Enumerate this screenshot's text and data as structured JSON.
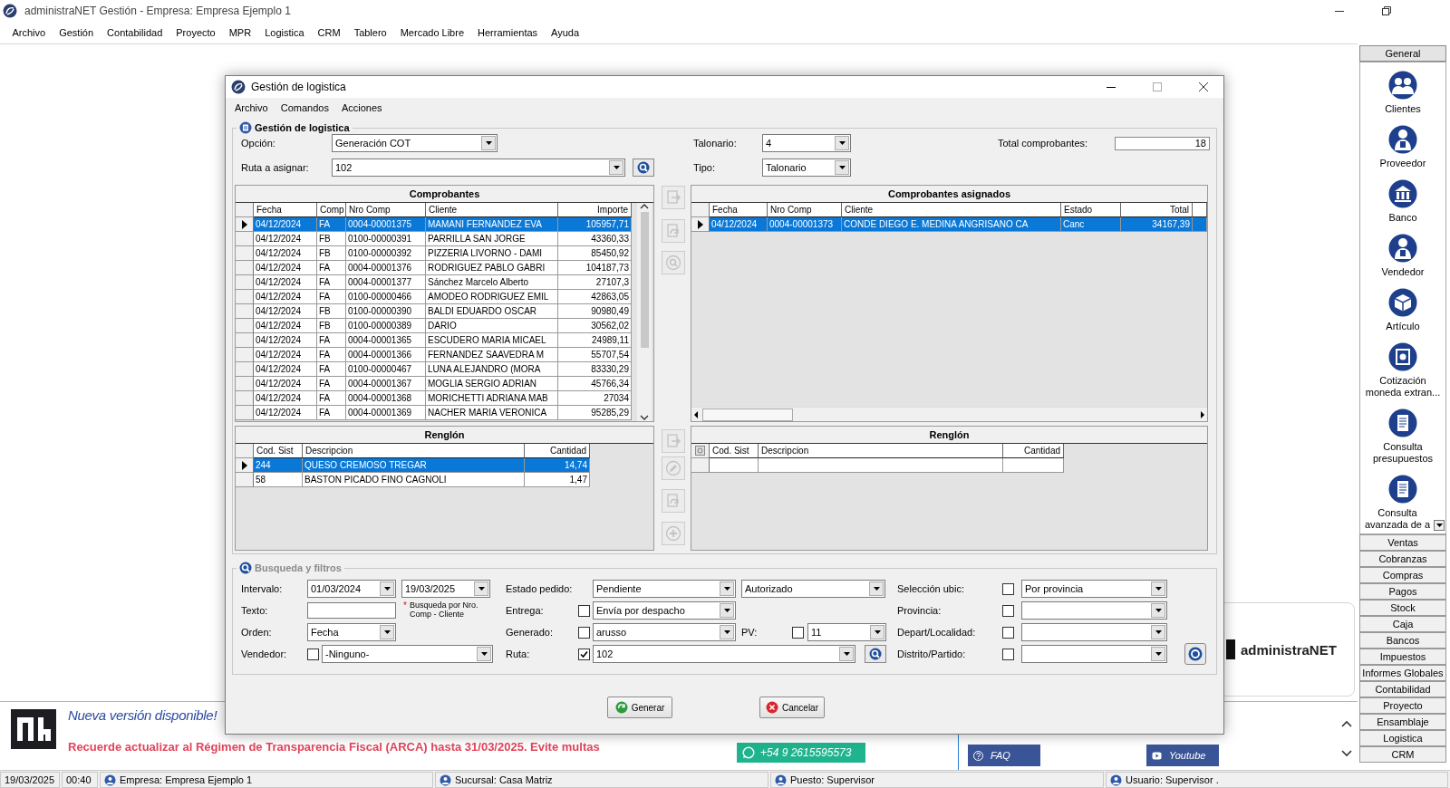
{
  "app_window": {
    "title": "administraNET Gestión - Empresa: Empresa Ejemplo 1",
    "menu": [
      "Archivo",
      "Gestión",
      "Contabilidad",
      "Proyecto",
      "MPR",
      "Logistica",
      "CRM",
      "Tablero",
      "Mercado Libre",
      "Herramientas",
      "Ayuda"
    ]
  },
  "dialog": {
    "title": "Gestión de logistica",
    "menu": [
      "Archivo",
      "Comandos",
      "Acciones"
    ],
    "group_title": "Gestión de logistica",
    "opcion": {
      "label": "Opción:",
      "value": "Generación COT"
    },
    "ruta_asignar": {
      "label": "Ruta a asignar:",
      "value": "102"
    },
    "talonario": {
      "label": "Talonario:",
      "value": "4"
    },
    "tipo": {
      "label": "Tipo:",
      "value": "Talonario"
    },
    "total_comprobantes": {
      "label": "Total comprobantes:",
      "value": "18"
    },
    "comprobantes": {
      "title": "Comprobantes",
      "columns": [
        "Fecha",
        "Comp",
        "Nro Comp",
        "Cliente",
        "Importe"
      ],
      "rows": [
        {
          "cells": [
            "04/12/2024",
            "FA",
            "0004-00001375",
            "MAMANI FERNANDEZ EVA",
            "105957,71"
          ],
          "selected": true
        },
        {
          "cells": [
            "04/12/2024",
            "FB",
            "0100-00000391",
            "PARRILLA SAN JORGE",
            "43360,33"
          ],
          "selected": false
        },
        {
          "cells": [
            "04/12/2024",
            "FB",
            "0100-00000392",
            "PIZZERIA LIVORNO - DAMI",
            "85450,92"
          ],
          "selected": false
        },
        {
          "cells": [
            "04/12/2024",
            "FA",
            "0004-00001376",
            "RODRIGUEZ PABLO GABRI",
            "104187,73"
          ],
          "selected": false
        },
        {
          "cells": [
            "04/12/2024",
            "FA",
            "0004-00001377",
            "Sánchez Marcelo Alberto",
            "27107,3"
          ],
          "selected": false
        },
        {
          "cells": [
            "04/12/2024",
            "FA",
            "0100-00000466",
            "AMODEO RODRIGUEZ EMIL",
            "42863,05"
          ],
          "selected": false
        },
        {
          "cells": [
            "04/12/2024",
            "FB",
            "0100-00000390",
            "BALDI EDUARDO OSCAR",
            "90980,49"
          ],
          "selected": false
        },
        {
          "cells": [
            "04/12/2024",
            "FB",
            "0100-00000389",
            "DARIO",
            "30562,02"
          ],
          "selected": false
        },
        {
          "cells": [
            "04/12/2024",
            "FA",
            "0004-00001365",
            "ESCUDERO MARIA MICAEL",
            "24989,11"
          ],
          "selected": false
        },
        {
          "cells": [
            "04/12/2024",
            "FA",
            "0004-00001366",
            "FERNANDEZ SAAVEDRA M",
            "55707,54"
          ],
          "selected": false
        },
        {
          "cells": [
            "04/12/2024",
            "FA",
            "0100-00000467",
            "LUNA ALEJANDRO (MORA",
            "83330,29"
          ],
          "selected": false
        },
        {
          "cells": [
            "04/12/2024",
            "FA",
            "0004-00001367",
            "MOGLIA SERGIO ADRIAN",
            "45766,34"
          ],
          "selected": false
        },
        {
          "cells": [
            "04/12/2024",
            "FA",
            "0004-00001368",
            "MORICHETTI ADRIANA MAB",
            "27034"
          ],
          "selected": false
        },
        {
          "cells": [
            "04/12/2024",
            "FA",
            "0004-00001369",
            "NACHER MARIA VERONICA",
            "95285,29"
          ],
          "selected": false
        }
      ]
    },
    "renglon": {
      "title": "Renglón",
      "columns": [
        "Cod. Sist",
        "Descripcion",
        "Cantidad"
      ],
      "rows": [
        {
          "cells": [
            "244",
            "QUESO CREMOSO TREGAR",
            "14,74"
          ],
          "selected": true
        },
        {
          "cells": [
            "58",
            "BASTON PICADO FINO CAGNOLI",
            "1,47"
          ],
          "selected": false
        }
      ]
    },
    "asignados": {
      "title": "Comprobantes asignados",
      "columns": [
        "Fecha",
        "Nro Comp",
        "Cliente",
        "Estado",
        "Total"
      ],
      "rows": [
        {
          "cells": [
            "04/12/2024",
            "0004-00001373",
            "CONDE DIEGO E. MEDINA ANGRISANO CA",
            "Canc",
            "34167,39"
          ],
          "selected": true
        }
      ]
    },
    "renglon_asignados": {
      "title": "Renglón",
      "columns": [
        "Cod. Sist",
        "Descripcion",
        "Cantidad"
      ]
    },
    "side_buttons_top": [
      {
        "kind": "page-arrow",
        "disabled": true
      },
      {
        "kind": "page-cycle",
        "disabled": true
      },
      {
        "kind": "page-search",
        "disabled": true
      }
    ],
    "side_buttons_bottom": [
      {
        "kind": "page-arrow",
        "disabled": true
      },
      {
        "kind": "edit",
        "disabled": true
      },
      {
        "kind": "page-cycle",
        "disabled": true
      },
      {
        "kind": "plus",
        "disabled": true
      }
    ],
    "filters": {
      "title": "Busqueda y filtros",
      "intervalo": {
        "label": "Intervalo:",
        "from": "01/03/2024",
        "to": "19/03/2025"
      },
      "texto": {
        "label": "Texto:",
        "note_mark": "*",
        "note": "Busqueda por Nro. Comp - Cliente"
      },
      "orden": {
        "label": "Orden:",
        "value": "Fecha"
      },
      "vendedor": {
        "label": "Vendedor:",
        "checked": false,
        "value": "-Ninguno-"
      },
      "estado_pedido": {
        "label": "Estado pedido:",
        "value": "Pendiente",
        "value_2": "Autorizado"
      },
      "entrega": {
        "label": "Entrega:",
        "checked": false,
        "value": "Envía por despacho"
      },
      "generado": {
        "label": "Generado:",
        "checked": false,
        "value": "arusso"
      },
      "pv": {
        "label": "PV:",
        "checked": false,
        "value": "11"
      },
      "ruta": {
        "label": "Ruta:",
        "checked": true,
        "value": "102"
      },
      "seleccion_ubic": {
        "label": "Selección ubic:",
        "checked": false,
        "value": "Por provincia"
      },
      "provincia": {
        "label": "Provincia:",
        "checked": false
      },
      "depart_localidad": {
        "label": "Depart/Localidad:",
        "checked": false
      },
      "distrito_partido": {
        "label": "Distrito/Partido:",
        "checked": false
      }
    },
    "buttons": [
      {
        "label": "Generar",
        "kind": "ok"
      },
      {
        "label": "Cancelar",
        "kind": "cancel"
      }
    ]
  },
  "sidebar": {
    "header": "General",
    "items": [
      {
        "label": "Clientes",
        "kind": "people"
      },
      {
        "label": "Proveedor",
        "kind": "person"
      },
      {
        "label": "Banco",
        "kind": "bank"
      },
      {
        "label": "Vendedor",
        "kind": "person"
      },
      {
        "label": "Artículo",
        "kind": "box"
      },
      {
        "label": "Cotización moneda extran...",
        "kind": "money"
      },
      {
        "label": "Consulta presupuestos",
        "kind": "document"
      },
      {
        "label": "Consulta avanzada de a",
        "kind": "document"
      }
    ],
    "sections": [
      "Ventas",
      "Cobranzas",
      "Compras",
      "Pagos",
      "Stock",
      "Caja",
      "Bancos",
      "Impuestos",
      "Informes Globales",
      "Contabilidad",
      "Proyecto",
      "Ensamblaje",
      "Logistica",
      "CRM"
    ]
  },
  "logo_card": {
    "text": "administraNET"
  },
  "banner": {
    "title": "Nueva versión disponible!",
    "message": "Recuerde actualizar al Régimen de Transparencia Fiscal (ARCA) hasta 31/03/2025. Evite multas",
    "whatsapp": "+54 9 2615595573",
    "links": [
      {
        "label": "FAQ",
        "kind": "help"
      },
      {
        "label": "Youtube",
        "kind": "video"
      }
    ]
  },
  "status_bar": [
    {
      "text": "19/03/2025",
      "kind": "plain"
    },
    {
      "text": "00:40",
      "kind": "plain"
    },
    {
      "text": "Empresa: Empresa Ejemplo 1",
      "kind": "user"
    },
    {
      "text": "Sucursal: Casa Matriz",
      "kind": "user"
    },
    {
      "text": "Puesto: Supervisor",
      "kind": "user"
    },
    {
      "text": "Usuario: Supervisor .",
      "kind": "user"
    }
  ]
}
